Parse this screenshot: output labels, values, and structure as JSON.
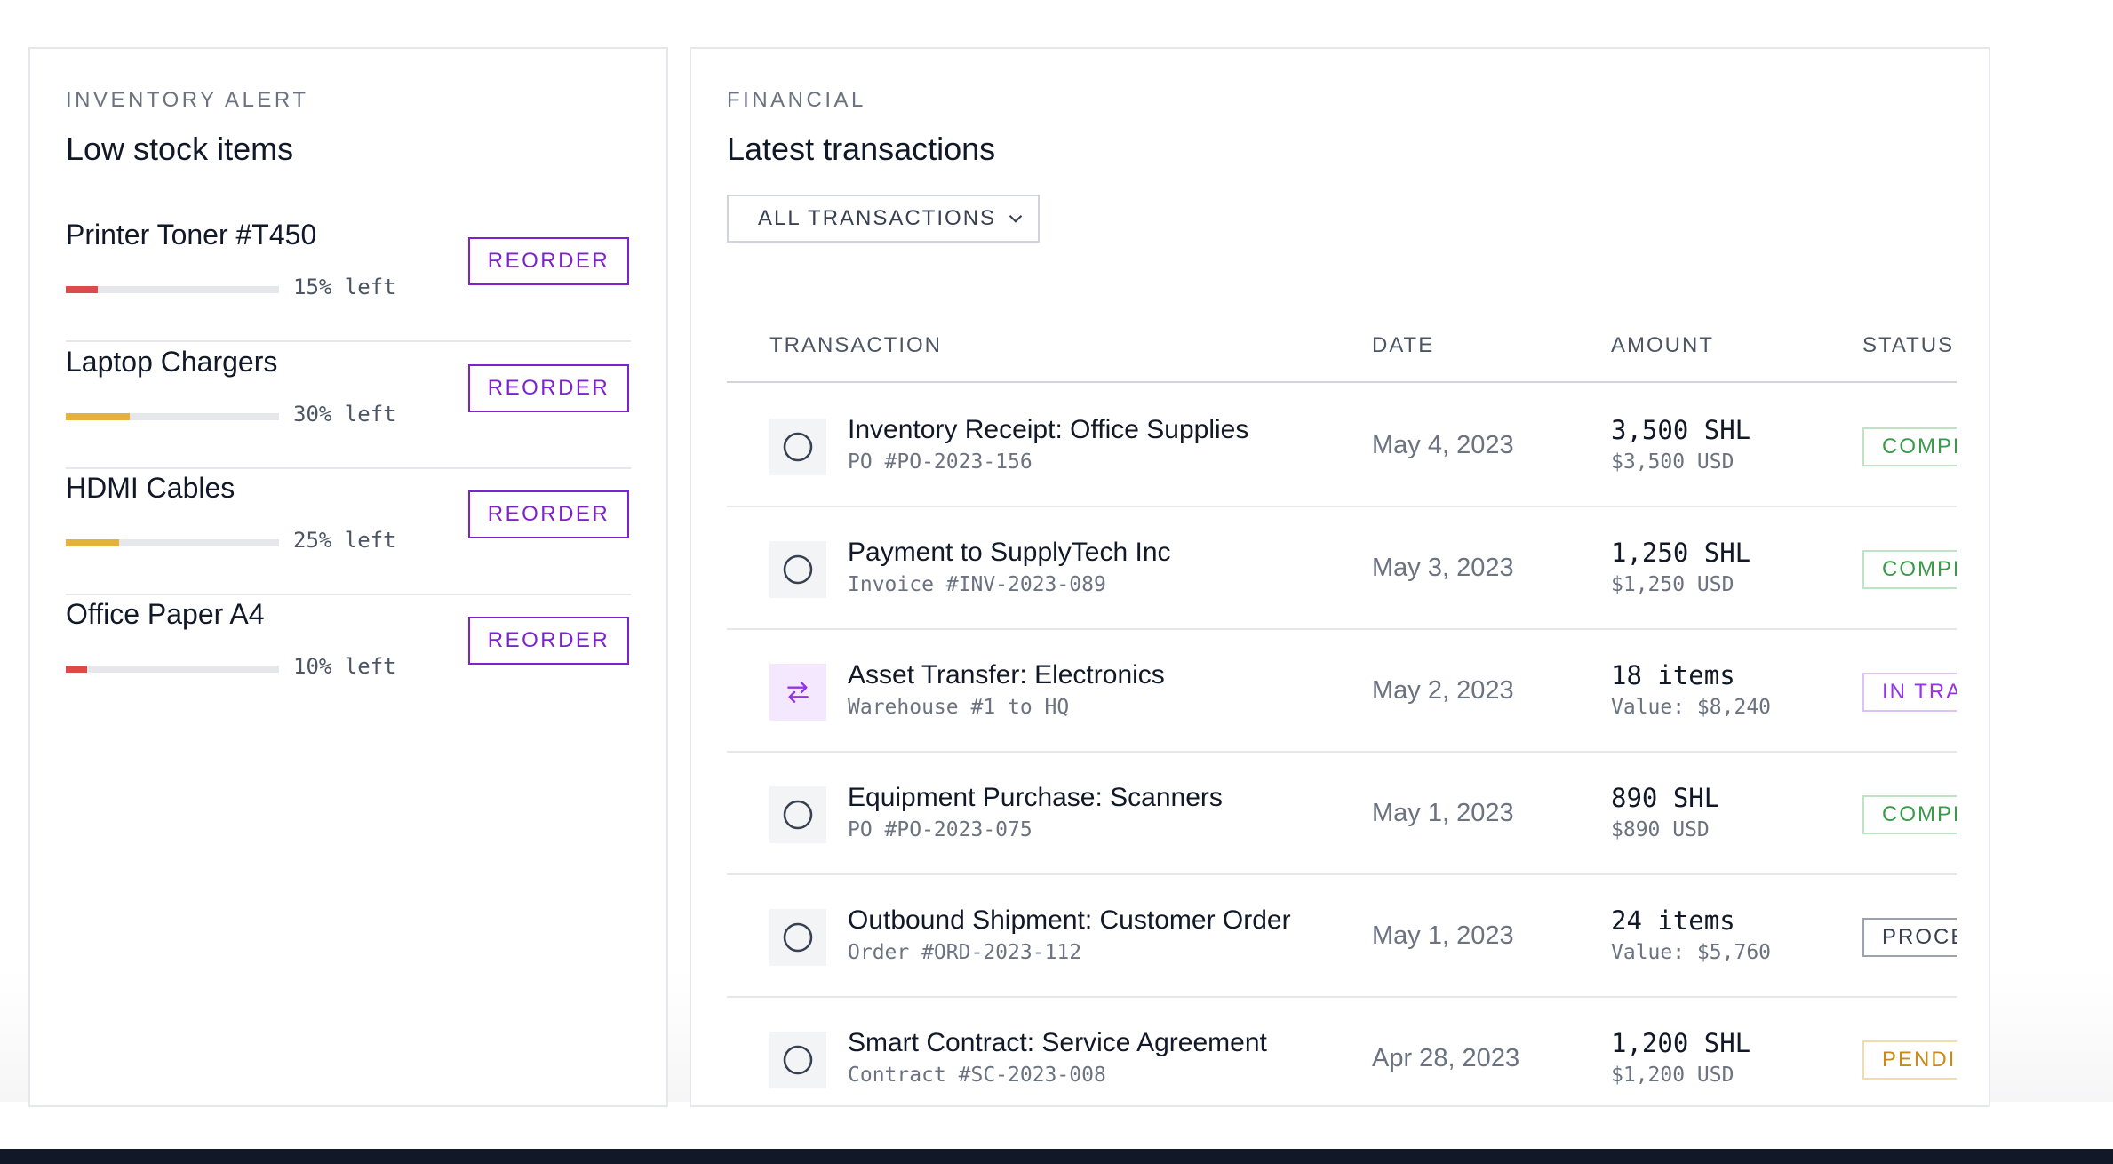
{
  "colors": {
    "accent": "#7e22ce",
    "low_stock": "#dc4a4a",
    "medium_stock": "#e4b23a",
    "completed": "#3a9a4a",
    "in_transit": "#9333ea",
    "processing": "#374151",
    "pending": "#c98a16"
  },
  "inventory": {
    "eyebrow": "INVENTORY ALERT",
    "title": "Low stock items",
    "items": [
      {
        "name": "Printer Toner #T450",
        "percent": 15,
        "pct_label": "15% left",
        "level": "low",
        "button": "REORDER"
      },
      {
        "name": "Laptop Chargers",
        "percent": 30,
        "pct_label": "30% left",
        "level": "medium",
        "button": "REORDER"
      },
      {
        "name": "HDMI Cables",
        "percent": 25,
        "pct_label": "25% left",
        "level": "medium",
        "button": "REORDER"
      },
      {
        "name": "Office Paper A4",
        "percent": 10,
        "pct_label": "10% left",
        "level": "low",
        "button": "REORDER"
      }
    ]
  },
  "financial": {
    "eyebrow": "FINANCIAL",
    "title": "Latest transactions",
    "filter": {
      "selected": "ALL TRANSACTIONS",
      "icon": "chevron-down-icon"
    },
    "columns": {
      "transaction": "TRANSACTION",
      "date": "DATE",
      "amount": "AMOUNT",
      "status": "STATUS"
    },
    "rows": [
      {
        "icon": "circle-icon",
        "title": "Inventory Receipt: Office Supplies",
        "sub": "PO #PO-2023-156",
        "date": "May 4, 2023",
        "amount": "3,500 SHL",
        "amount_sub": "$3,500 USD",
        "status": "COMPLETED",
        "status_kind": "completed"
      },
      {
        "icon": "circle-icon",
        "title": "Payment to SupplyTech Inc",
        "sub": "Invoice #INV-2023-089",
        "date": "May 3, 2023",
        "amount": "1,250 SHL",
        "amount_sub": "$1,250 USD",
        "status": "COMPLETED",
        "status_kind": "completed"
      },
      {
        "icon": "transfer-arrows-icon",
        "title": "Asset Transfer: Electronics",
        "sub": "Warehouse #1 to HQ",
        "date": "May 2, 2023",
        "amount": "18 items",
        "amount_sub": "Value: $8,240",
        "status": "IN TRANSIT",
        "status_kind": "in_transit"
      },
      {
        "icon": "circle-icon",
        "title": "Equipment Purchase: Scanners",
        "sub": "PO #PO-2023-075",
        "date": "May 1, 2023",
        "amount": "890 SHL",
        "amount_sub": "$890 USD",
        "status": "COMPLETED",
        "status_kind": "completed"
      },
      {
        "icon": "circle-icon",
        "title": "Outbound Shipment: Customer Order",
        "sub": "Order #ORD-2023-112",
        "date": "May 1, 2023",
        "amount": "24 items",
        "amount_sub": "Value: $5,760",
        "status": "PROCESSING",
        "status_kind": "processing"
      },
      {
        "icon": "circle-icon",
        "title": "Smart Contract: Service Agreement",
        "sub": "Contract #SC-2023-008",
        "date": "Apr 28, 2023",
        "amount": "1,200 SHL",
        "amount_sub": "$1,200 USD",
        "status": "PENDING",
        "status_kind": "pending"
      }
    ]
  }
}
